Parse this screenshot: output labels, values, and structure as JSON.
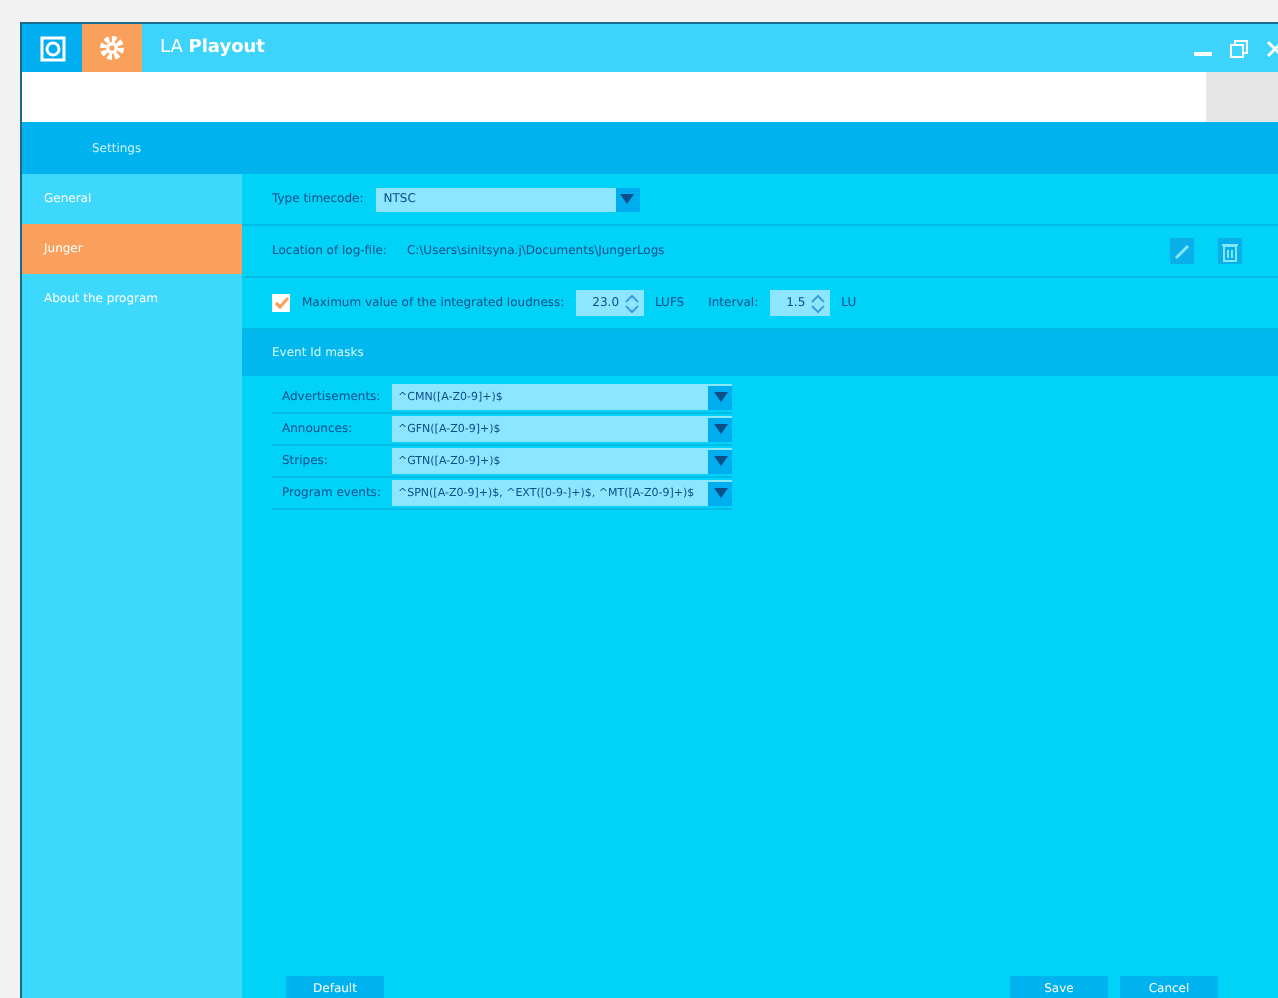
{
  "window": {
    "title": "LA **Playout**"
  },
  "toolbar_tabs": [
    {
      "kind": "camera",
      "selected": false
    },
    {
      "kind": "gear",
      "selected": true
    }
  ],
  "breadcrumb": "Settings",
  "sidebar": {
    "items": [
      {
        "label": "General",
        "selected": false
      },
      {
        "label": "Junger",
        "selected": true
      },
      {
        "label": "About the program",
        "selected": false
      }
    ]
  },
  "timecode": {
    "label": "Type timecode:",
    "value": "NTSC"
  },
  "log_file": {
    "label": "Location of log-file:",
    "value": "C:\\Users\\sinitsyna.j\\Documents\\JungerLogs"
  },
  "loudness": {
    "checked": true,
    "label": "Maximum value of the integrated loudness:",
    "value": "23.0",
    "unit": "LUFS",
    "interval_label": "Interval:",
    "interval_value": "1.5",
    "interval_unit": "LU"
  },
  "event_masks": {
    "title": "Event Id masks",
    "rows": [
      {
        "label": "Advertisements:",
        "value": "^CMN([A-Z0-9]+)$"
      },
      {
        "label": "Announces:",
        "value": "^GFN([A-Z0-9]+)$"
      },
      {
        "label": "Stripes:",
        "value": "^GTN([A-Z0-9]+)$"
      },
      {
        "label": "Program events:",
        "value": "^SPN([A-Z0-9]+)$, ^EXT([0-9-]+)$, ^MT([A-Z0-9]+)$"
      }
    ]
  },
  "buttons": {
    "default": "Default",
    "save": "Save",
    "cancel": "Cancel"
  }
}
